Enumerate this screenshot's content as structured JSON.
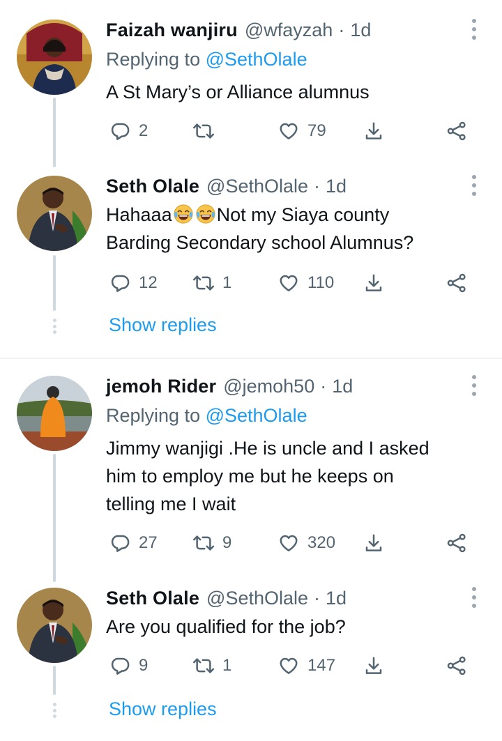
{
  "tweets": [
    {
      "name": "Faizah wanjiru",
      "handle": "@wfayzah",
      "separator": "·",
      "time": "1d",
      "replying_prefix": "Replying to",
      "replying_to": "@SethOlale",
      "lines": [
        "A St Mary’s  or Alliance alumnus"
      ],
      "reply_count": "2",
      "retweet_count": "",
      "like_count": "79"
    },
    {
      "name": "Seth Olale",
      "handle": "@SethOlale",
      "separator": "·",
      "time": "1d",
      "line1_pre": "Hahaaa",
      "line1_post": "Not my Siaya county",
      "line2": "Barding Secondary school Alumnus?",
      "emoji": "face-with-tears-of-joy",
      "reply_count": "12",
      "retweet_count": "1",
      "like_count": "110"
    },
    {
      "name": "jemoh Rider",
      "handle": "@jemoh50",
      "separator": "·",
      "time": "1d",
      "replying_prefix": "Replying to",
      "replying_to": "@SethOlale",
      "lines": [
        "Jimmy wanjigi .He is uncle  and I asked",
        "him to employ me but he keeps on",
        "telling me I wait"
      ],
      "reply_count": "27",
      "retweet_count": "9",
      "like_count": "320"
    },
    {
      "name": "Seth Olale",
      "handle": "@SethOlale",
      "separator": "·",
      "time": "1d",
      "lines": [
        "Are you qualified for the job?"
      ],
      "reply_count": "9",
      "retweet_count": "1",
      "like_count": "147"
    }
  ],
  "show_replies_label": "Show replies",
  "icons": {
    "reply": "reply-icon",
    "retweet": "retweet-icon",
    "like": "heart-icon",
    "download": "download-icon",
    "share": "share-icon",
    "more": "more-options-icon"
  },
  "colors": {
    "link": "#1d9bf0",
    "secondary_text": "#536471",
    "thread_line": "#cfd9de"
  }
}
